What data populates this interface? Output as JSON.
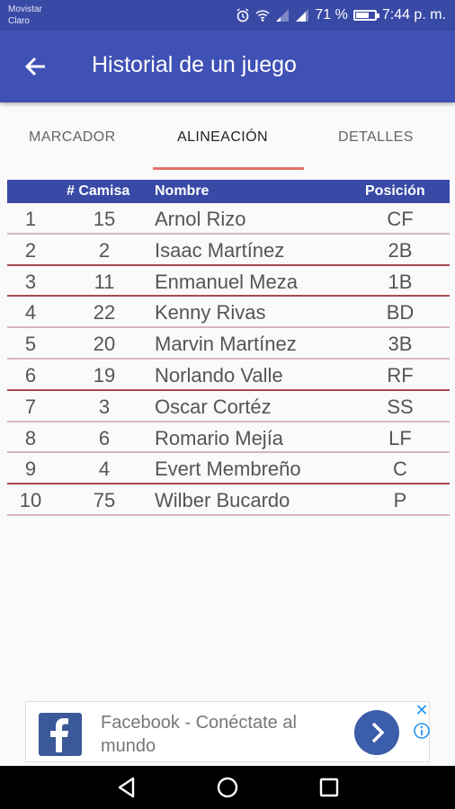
{
  "status_bar": {
    "carrier_1": "Movistar",
    "carrier_2": "Claro",
    "battery": "71 %",
    "battery_level": 0.71,
    "time": "7:44 p. m."
  },
  "app_bar": {
    "title": "Historial de un juego",
    "back_icon": "arrow-back-icon"
  },
  "tabs": [
    {
      "label": "MARCADOR",
      "active": false
    },
    {
      "label": "ALINEACIÓN",
      "active": true
    },
    {
      "label": "DETALLES",
      "active": false
    }
  ],
  "table": {
    "headers": [
      "",
      "# Camisa",
      "Nombre",
      "Posición"
    ],
    "rows": [
      {
        "n": "1",
        "camisa": "15",
        "nombre": "Arnol Rizo",
        "posicion": "CF"
      },
      {
        "n": "2",
        "camisa": "2",
        "nombre": "Isaac Martínez",
        "posicion": "2B"
      },
      {
        "n": "3",
        "camisa": "11",
        "nombre": "Enmanuel Meza",
        "posicion": "1B"
      },
      {
        "n": "4",
        "camisa": "22",
        "nombre": "Kenny Rivas",
        "posicion": "BD"
      },
      {
        "n": "5",
        "camisa": "20",
        "nombre": "Marvin Martínez",
        "posicion": "3B"
      },
      {
        "n": "6",
        "camisa": "19",
        "nombre": "Norlando Valle",
        "posicion": "RF"
      },
      {
        "n": "7",
        "camisa": "3",
        "nombre": "Oscar Cortéz",
        "posicion": "SS"
      },
      {
        "n": "8",
        "camisa": "6",
        "nombre": "Romario Mejía",
        "posicion": "LF"
      },
      {
        "n": "9",
        "camisa": "4",
        "nombre": "Evert Membreño",
        "posicion": "C"
      },
      {
        "n": "10",
        "camisa": "75",
        "nombre": "Wilber Bucardo",
        "posicion": "P"
      }
    ]
  },
  "ad": {
    "text": "Facebook - Conéctate al mundo",
    "logo_icon": "facebook-icon",
    "close_icon": "close-icon",
    "info_icon": "info-icon",
    "go_icon": "chevron-right-icon"
  },
  "colors": {
    "primary": "#3f51b5",
    "primary_dark": "#3849a6",
    "accent": "#e57368"
  }
}
